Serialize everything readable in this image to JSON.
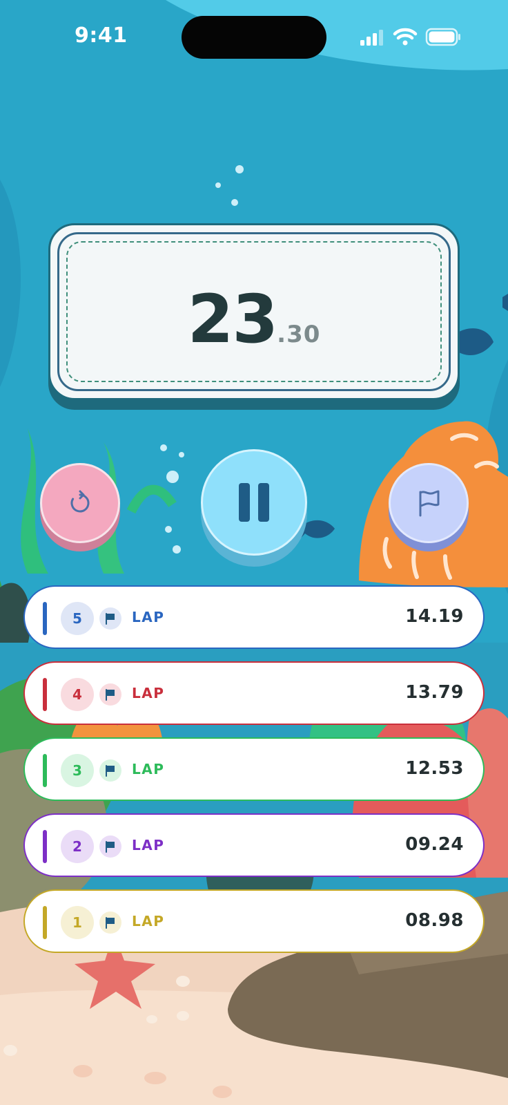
{
  "status_bar": {
    "time": "9:41",
    "signal_icon": "cellular-signal-icon",
    "wifi_icon": "wifi-icon",
    "battery_icon": "battery-icon"
  },
  "timer": {
    "seconds": "23",
    "centiseconds": ".30"
  },
  "controls": {
    "reset": {
      "icon": "reset-icon",
      "color": "#f4a8bf"
    },
    "pause": {
      "icon": "pause-icon",
      "color": "#8fe0fb"
    },
    "lap": {
      "icon": "flag-icon",
      "color": "#c6d2fb"
    }
  },
  "laps": [
    {
      "number": "5",
      "label": "LAP",
      "time": "14.19",
      "color": "#2a66c0",
      "tint": "#dfe6f6"
    },
    {
      "number": "4",
      "label": "LAP",
      "time": "13.79",
      "color": "#c92f3c",
      "tint": "#f9dbdf"
    },
    {
      "number": "3",
      "label": "LAP",
      "time": "12.53",
      "color": "#2dbb5a",
      "tint": "#d9f5e2"
    },
    {
      "number": "2",
      "label": "LAP",
      "time": "09.24",
      "color": "#7d2fc6",
      "tint": "#eadcf7"
    },
    {
      "number": "1",
      "label": "LAP",
      "time": "08.98",
      "color": "#c4a827",
      "tint": "#f6f0d4"
    }
  ]
}
